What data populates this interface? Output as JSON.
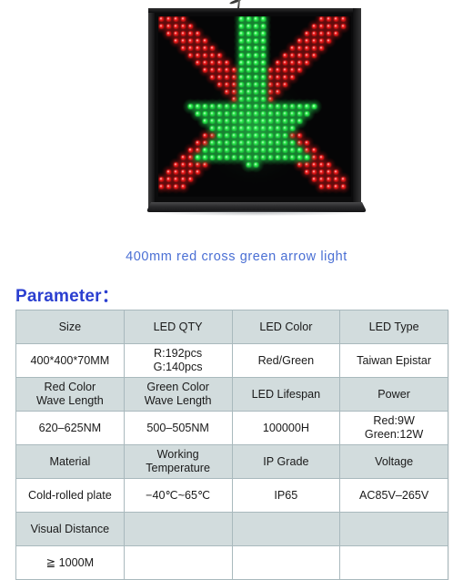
{
  "photo": {
    "alt_name": "led-traffic-light-photo",
    "caption": "400mm red cross green arrow light",
    "housing_color": "#0b0b0c",
    "red_led_color": "#ff1a1a",
    "green_led_color": "#2bff4d",
    "cross_color_name": "red",
    "arrow_color_name": "green"
  },
  "section": {
    "heading": "Parameter：",
    "heading_color": "#2b3fd0"
  },
  "spec_table": {
    "header_bg": "#d2dcdd",
    "border_color": "#a9b9bd",
    "columns": 4,
    "rows": [
      {
        "type": "header",
        "cells": [
          "Size",
          "LED QTY",
          "LED Color",
          "LED Type"
        ]
      },
      {
        "type": "value",
        "cells": [
          "400*400*70MM",
          "R:192pcs\nG:140pcs",
          "Red/Green",
          "Taiwan Epistar"
        ]
      },
      {
        "type": "header",
        "cells": [
          "Red Color\nWave Length",
          "Green Color\nWave Length",
          "LED Lifespan",
          "Power"
        ]
      },
      {
        "type": "value",
        "cells": [
          "620–625NM",
          "500–505NM",
          "100000H",
          "Red:9W\nGreen:12W"
        ]
      },
      {
        "type": "header",
        "cells": [
          "Material",
          "Working\nTemperature",
          "IP Grade",
          "Voltage"
        ]
      },
      {
        "type": "value",
        "cells": [
          "Cold-rolled plate",
          "−40℃~65℃",
          "IP65",
          "AC85V–265V"
        ]
      },
      {
        "type": "header",
        "cells": [
          "Visual Distance",
          "",
          "",
          ""
        ]
      },
      {
        "type": "value",
        "cells": [
          "≧ 1000M",
          "",
          "",
          ""
        ]
      }
    ]
  }
}
